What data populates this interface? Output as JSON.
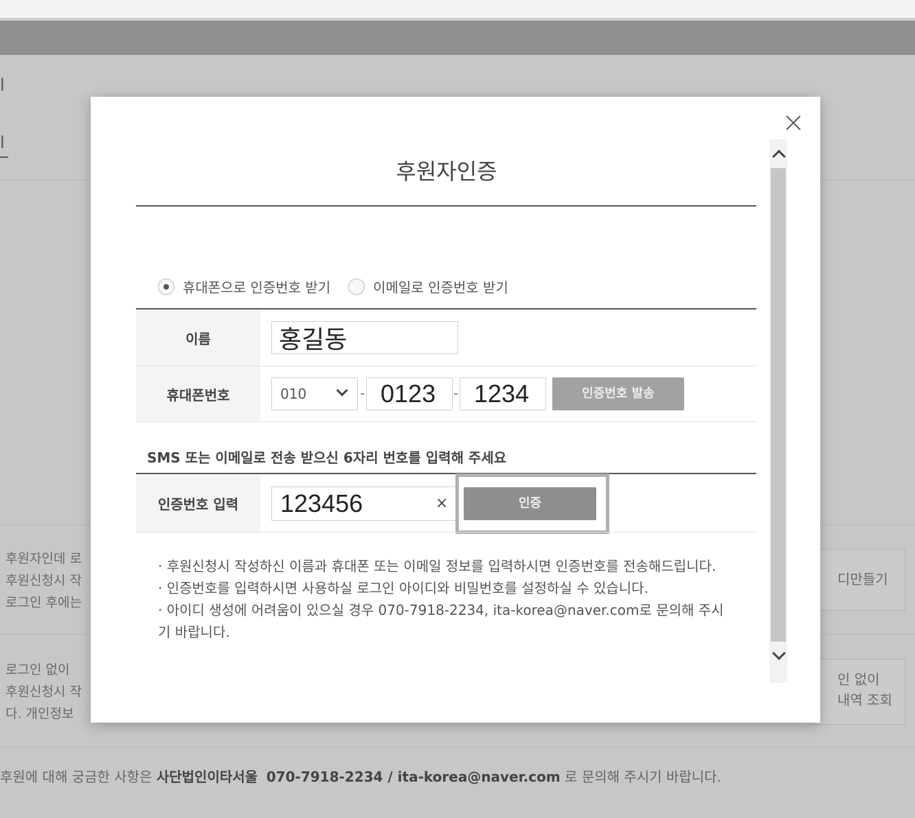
{
  "background": {
    "side_glyph_top": "l",
    "side_glyph_bottom": "l",
    "block1": [
      "후원자인데 로",
      "후원신청시 작",
      "로그인 후에는"
    ],
    "block2": [
      "로그인 없이 ",
      "후원신청시 작",
      "다. 개인정보"
    ],
    "button1_label": "디만들기",
    "button2_lines": [
      "인 없이",
      "내역 조회"
    ],
    "footer": {
      "prefix": "후원에 대해 궁금한 사항은 ",
      "org": "사단법인이타서울",
      "contact": "070-7918-2234 / ita-korea@naver.com",
      "suffix": " 로 문의해 주시기 바랍니다."
    }
  },
  "modal": {
    "title": "후원자인증",
    "close_icon": "close-icon",
    "radio_options": [
      {
        "label": "휴대폰으로 인증번호 받기",
        "checked": true
      },
      {
        "label": "이메일로 인증번호 받기",
        "checked": false
      }
    ],
    "form": {
      "name_label": "이름",
      "name_value": "홍길동",
      "phone_label": "휴대폰번호",
      "phone_prefix": "010",
      "phone_mid": "0123",
      "phone_last": "1234",
      "send_button": "인증번호 발송",
      "dash": "-"
    },
    "sms_notice": "SMS 또는 이메일로 전송 받으신 6자리 번호를 입력해 주세요",
    "code": {
      "label": "인증번호 입력",
      "value": "123456",
      "clear_symbol": "×",
      "verify_button": "인증"
    },
    "notes": [
      "· 후원신청시 작성하신 이름과 휴대폰 또는 이메일 정보를 입력하시면 인증번호를 전송해드립니다.",
      "· 인증번호를 입력하시면 사용하실 로그인 아이디와 비밀번호를 설정하실 수 있습니다.",
      "· 아이디 생성에 어려움이 있으실 경우 070-7918-2234, ita-korea@naver.com로 문의해 주시기 바랍니다."
    ]
  }
}
